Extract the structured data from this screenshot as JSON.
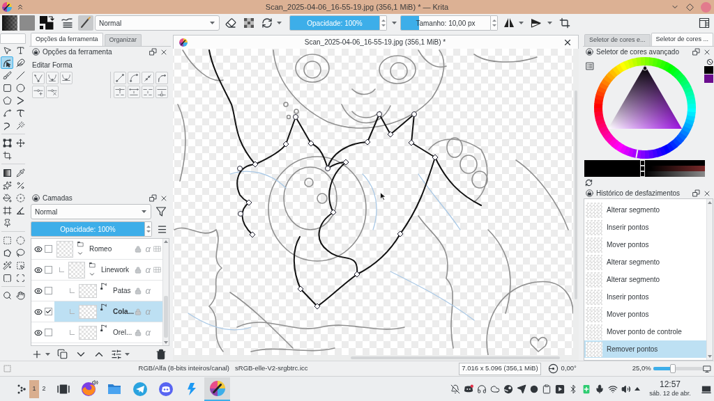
{
  "window": {
    "title": "Scan_2025-04-06_16-55-19.jpg (356,1 MiB) * — Krita"
  },
  "toolbar": {
    "blend_mode": "Normal",
    "opacity": {
      "label": "Opacidade: 100%",
      "level": 1
    },
    "size": {
      "label": "Tamanho: 10,00 px",
      "level": 0.2
    }
  },
  "toolbox": {
    "groups": [
      {
        "tools": [
          {
            "selected": false
          },
          {
            "selected": false
          },
          {
            "selected": true
          },
          {
            "selected": false
          },
          {
            "selected": false
          },
          {
            "selected": false
          },
          {
            "selected": false
          },
          {
            "selected": false
          },
          {
            "selected": false
          },
          {
            "selected": false
          },
          {
            "selected": false
          },
          {
            "selected": false
          },
          {
            "selected": false
          },
          {
            "selected": false
          }
        ]
      },
      {
        "tools": [
          {
            "selected": false
          },
          {
            "selected": false
          },
          {
            "selected": false
          }
        ]
      },
      {
        "tools": [
          {
            "selected": false
          },
          {
            "selected": false
          },
          {
            "selected": false
          },
          {
            "selected": false
          },
          {
            "selected": false
          },
          {
            "selected": false
          },
          {
            "selected": false
          },
          {
            "selected": false
          },
          {
            "selected": false
          }
        ]
      },
      {
        "tools": [
          {
            "selected": false
          },
          {
            "selected": false
          },
          {
            "selected": false
          },
          {
            "selected": false
          },
          {
            "selected": false
          },
          {
            "selected": false
          },
          {
            "selected": false
          },
          {
            "selected": false
          }
        ]
      },
      {
        "tools": [
          {
            "selected": false
          },
          {
            "selected": false
          }
        ]
      }
    ]
  },
  "left_dock": {
    "tabs": [
      {
        "label": "Opções da ferramenta",
        "selected": true
      },
      {
        "label": "Organizar",
        "selected": false
      }
    ],
    "tool_options": {
      "title": "Opções da ferramenta",
      "section": "Editar Forma"
    },
    "layers": {
      "title": "Camadas",
      "blend_mode": "Normal",
      "opacity": {
        "label": "Opacidade: 100%",
        "level": 1
      },
      "items": [
        {
          "name": "Romeo",
          "kind": "group",
          "visible": true,
          "checked": false,
          "selected": false,
          "expanded": true,
          "alpha": "α",
          "children": [
            {
              "name": "Linework",
              "kind": "group",
              "visible": true,
              "checked": false,
              "selected": false,
              "expanded": true,
              "alpha": "α",
              "children": [
                {
                  "name": "Patas",
                  "kind": "vector",
                  "visible": true,
                  "checked": false,
                  "selected": false,
                  "alpha": "α"
                },
                {
                  "name": "Cola...",
                  "kind": "vector",
                  "visible": true,
                  "checked": true,
                  "selected": true,
                  "alpha": "α"
                },
                {
                  "name": "Orel...",
                  "kind": "vector",
                  "visible": true,
                  "checked": false,
                  "selected": false,
                  "alpha": "α"
                }
              ]
            }
          ]
        }
      ]
    }
  },
  "document": {
    "title": "Scan_2025-04-06_16-55-19.jpg (356,1 MiB) *"
  },
  "right_dock": {
    "tabs": [
      {
        "label": "Seletor de cores e...",
        "selected": false
      },
      {
        "label": "Seletor de cores ...",
        "selected": true
      }
    ],
    "color_selector": {
      "title": "Seletor de cores avançado",
      "sliders": [
        {
          "level": 0.48
        },
        {
          "level": 0.48
        },
        {
          "level": 0.48
        }
      ]
    },
    "history": {
      "title": "Histórico de desfazimentos",
      "items": [
        {
          "label": "Alterar segmento",
          "selected": false
        },
        {
          "label": "Inserir pontos",
          "selected": false
        },
        {
          "label": "Mover pontos",
          "selected": false
        },
        {
          "label": "Alterar segmento",
          "selected": false
        },
        {
          "label": "Alterar segmento",
          "selected": false
        },
        {
          "label": "Inserir pontos",
          "selected": false
        },
        {
          "label": "Mover pontos",
          "selected": false
        },
        {
          "label": "Mover ponto de controle",
          "selected": false
        },
        {
          "label": "Remover pontos",
          "selected": true
        }
      ]
    }
  },
  "status_bar": {
    "color_space": "RGB/Alfa (8-bits inteiros/canal)",
    "profile": "sRGB-elle-V2-srgbtrc.icc",
    "dimensions": "7.016 x 5.096 (356,1 MiB)",
    "rotation": "0,00°",
    "zoom": "25,0%",
    "zoom_slider": {
      "level": 0.4
    }
  },
  "taskbar": {
    "pager": [
      {
        "label": "1",
        "selected": true
      },
      {
        "label": "2",
        "selected": false
      }
    ],
    "apps": [
      {
        "kind": "browser",
        "active": false,
        "audio": true
      },
      {
        "kind": "files",
        "active": false,
        "audio": false
      },
      {
        "kind": "messenger",
        "active": false,
        "audio": false
      },
      {
        "kind": "chat",
        "active": false,
        "audio": false
      },
      {
        "kind": "connect",
        "active": false,
        "audio": false
      },
      {
        "kind": "paint",
        "active": true,
        "audio": false
      }
    ],
    "clock": {
      "time": "12:57",
      "date": "sáb. 12 de abr."
    }
  }
}
